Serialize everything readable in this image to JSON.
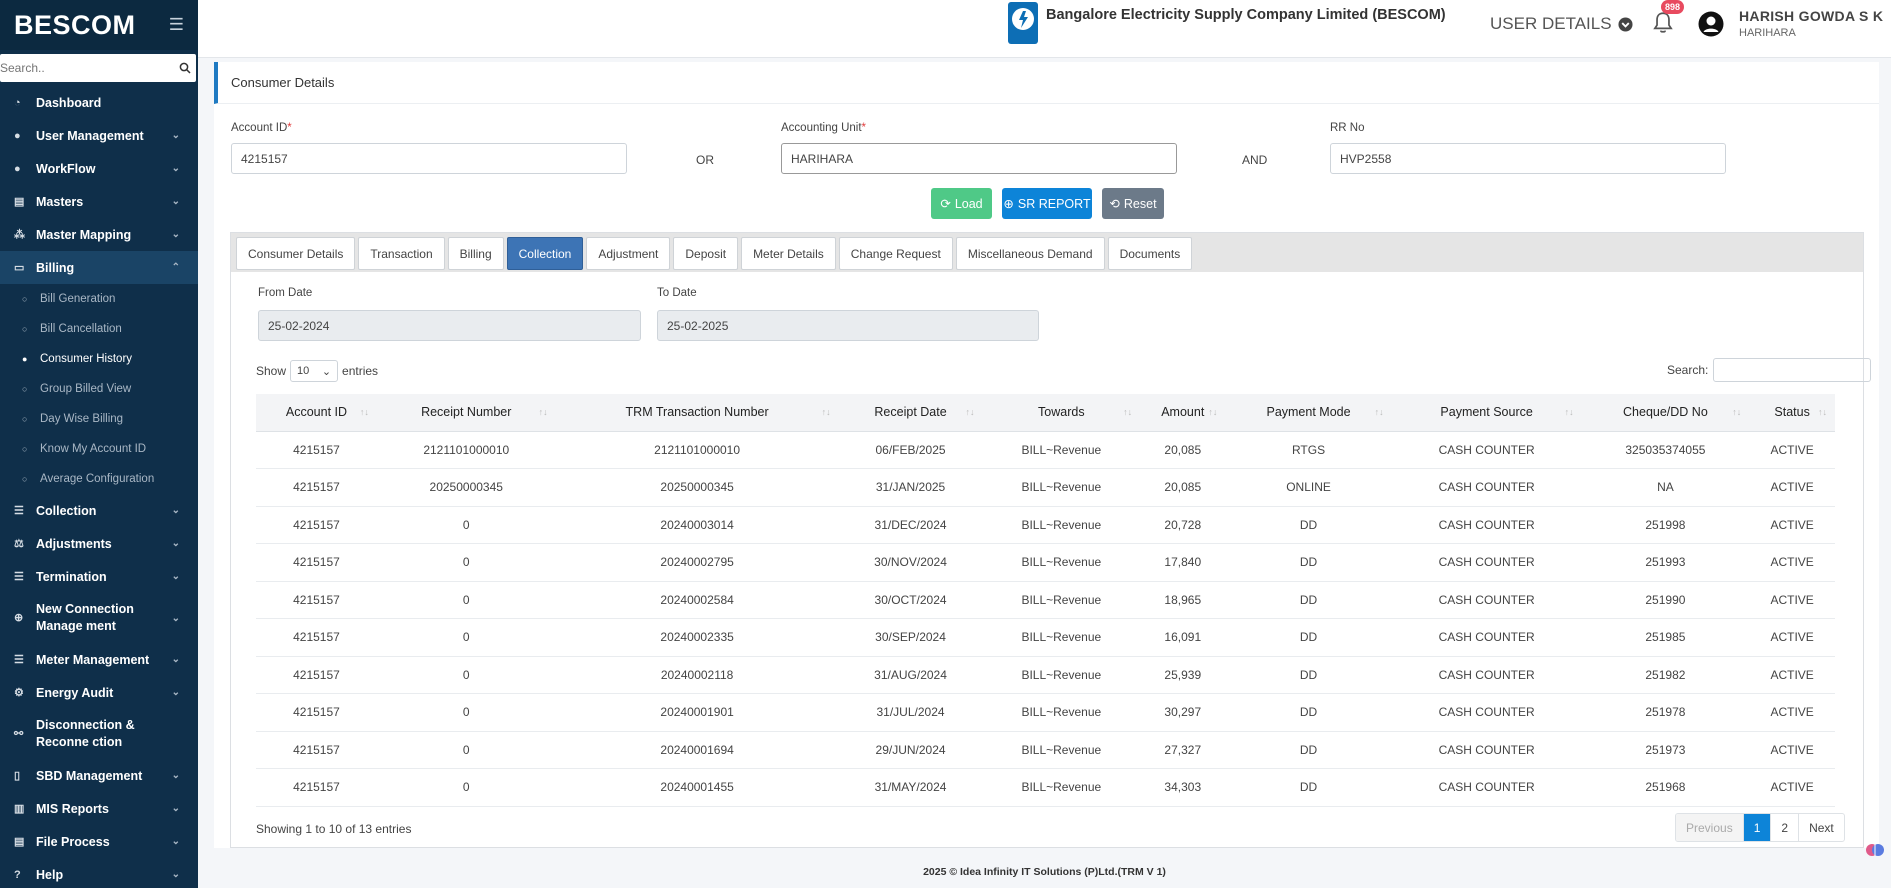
{
  "sidebar": {
    "brand": "BESCOM",
    "search_placeholder": "Search..",
    "items": [
      {
        "label": "Dashboard"
      },
      {
        "label": "User Management"
      },
      {
        "label": "WorkFlow"
      },
      {
        "label": "Masters"
      },
      {
        "label": "Master Mapping"
      },
      {
        "label": "Billing"
      },
      {
        "label": "Collection"
      },
      {
        "label": "Adjustments"
      },
      {
        "label": "Termination"
      },
      {
        "label": "New Connection Manage ment"
      },
      {
        "label": "Meter Management"
      },
      {
        "label": "Energy Audit"
      },
      {
        "label": "Disconnection & Reconne ction"
      },
      {
        "label": "SBD Management"
      },
      {
        "label": "MIS Reports"
      },
      {
        "label": "File Process"
      },
      {
        "label": "Help"
      }
    ],
    "billing_sub": [
      {
        "label": "Bill Generation"
      },
      {
        "label": "Bill Cancellation"
      },
      {
        "label": "Consumer History"
      },
      {
        "label": "Group Billed View"
      },
      {
        "label": "Day Wise Billing"
      },
      {
        "label": "Know My Account ID"
      },
      {
        "label": "Average Configuration"
      }
    ]
  },
  "header": {
    "logo_text": "BESCOM",
    "company": "Bangalore Electricity Supply Company Limited (BESCOM)",
    "user_details": "USER DETAILS",
    "notification_count": "898",
    "user_name": "HARISH GOWDA S K",
    "user_location": "HARIHARA"
  },
  "form": {
    "card_title": "Consumer Details",
    "account_id_label": "Account ID",
    "account_id_value": "4215157",
    "or_text": "OR",
    "accounting_unit_label": "Accounting Unit",
    "accounting_unit_value": "HARIHARA",
    "and_text": "AND",
    "rr_label": "RR No",
    "rr_value": "HVP2558",
    "required_mark": "*",
    "load_label": "Load",
    "sr_label": "SR REPORT",
    "reset_label": "Reset"
  },
  "tabs": [
    {
      "label": "Consumer Details"
    },
    {
      "label": "Transaction"
    },
    {
      "label": "Billing"
    },
    {
      "label": "Collection"
    },
    {
      "label": "Adjustment"
    },
    {
      "label": "Deposit"
    },
    {
      "label": "Meter Details"
    },
    {
      "label": "Change Request"
    },
    {
      "label": "Miscellaneous Demand"
    },
    {
      "label": "Documents"
    }
  ],
  "collection": {
    "from_label": "From Date",
    "from_value": "25-02-2024",
    "to_label": "To Date",
    "to_value": "25-02-2025",
    "show_label": "Show",
    "entries_value": "10",
    "entries_label": "entries",
    "search_label": "Search:",
    "columns": [
      "Account ID",
      "Receipt Number",
      "TRM Transaction Number",
      "Receipt Date",
      "Towards",
      "Amount",
      "Payment Mode",
      "Payment Source",
      "Cheque/DD No",
      "Status"
    ],
    "rows": [
      [
        "4215157",
        "2121101000010",
        "2121101000010",
        "06/FEB/2025",
        "BILL~Revenue",
        "20,085",
        "RTGS",
        "CASH COUNTER",
        "325035374055",
        "ACTIVE"
      ],
      [
        "4215157",
        "20250000345",
        "20250000345",
        "31/JAN/2025",
        "BILL~Revenue",
        "20,085",
        "ONLINE",
        "CASH COUNTER",
        "NA",
        "ACTIVE"
      ],
      [
        "4215157",
        "0",
        "20240003014",
        "31/DEC/2024",
        "BILL~Revenue",
        "20,728",
        "DD",
        "CASH COUNTER",
        "251998",
        "ACTIVE"
      ],
      [
        "4215157",
        "0",
        "20240002795",
        "30/NOV/2024",
        "BILL~Revenue",
        "17,840",
        "DD",
        "CASH COUNTER",
        "251993",
        "ACTIVE"
      ],
      [
        "4215157",
        "0",
        "20240002584",
        "30/OCT/2024",
        "BILL~Revenue",
        "18,965",
        "DD",
        "CASH COUNTER",
        "251990",
        "ACTIVE"
      ],
      [
        "4215157",
        "0",
        "20240002335",
        "30/SEP/2024",
        "BILL~Revenue",
        "16,091",
        "DD",
        "CASH COUNTER",
        "251985",
        "ACTIVE"
      ],
      [
        "4215157",
        "0",
        "20240002118",
        "31/AUG/2024",
        "BILL~Revenue",
        "25,939",
        "DD",
        "CASH COUNTER",
        "251982",
        "ACTIVE"
      ],
      [
        "4215157",
        "0",
        "20240001901",
        "31/JUL/2024",
        "BILL~Revenue",
        "30,297",
        "DD",
        "CASH COUNTER",
        "251978",
        "ACTIVE"
      ],
      [
        "4215157",
        "0",
        "20240001694",
        "29/JUN/2024",
        "BILL~Revenue",
        "27,327",
        "DD",
        "CASH COUNTER",
        "251973",
        "ACTIVE"
      ],
      [
        "4215157",
        "0",
        "20240001455",
        "31/MAY/2024",
        "BILL~Revenue",
        "34,303",
        "DD",
        "CASH COUNTER",
        "251968",
        "ACTIVE"
      ]
    ],
    "info": "Showing 1 to 10 of 13 entries",
    "pager": {
      "previous": "Previous",
      "page1": "1",
      "page2": "2",
      "next": "Next"
    }
  },
  "footer": "2025 © Idea Infinity IT Solutions (P)Ltd.(TRM V 1)",
  "colors": {
    "sidebar": "#0f2f4a",
    "accent": "#0d84d8",
    "active_tab": "#3d74b5",
    "load": "#4fc987"
  }
}
